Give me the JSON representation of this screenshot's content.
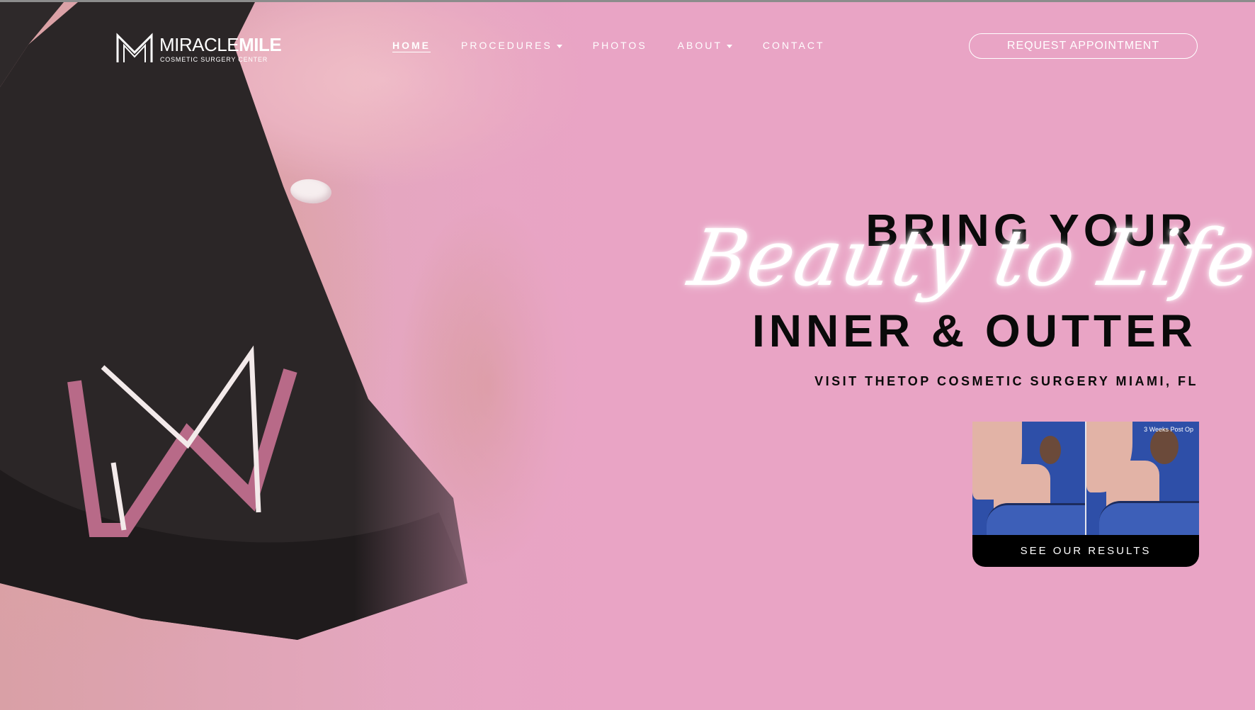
{
  "logo": {
    "word_light": "MIRACLE",
    "word_bold": "MILE",
    "tagline": "COSMETIC SURGERY CENTER"
  },
  "nav": {
    "items": [
      {
        "label": "HOME",
        "active": true,
        "dropdown": false
      },
      {
        "label": "PROCEDURES",
        "active": false,
        "dropdown": true
      },
      {
        "label": "PHOTOS",
        "active": false,
        "dropdown": false
      },
      {
        "label": "ABOUT",
        "active": false,
        "dropdown": true
      },
      {
        "label": "CONTACT",
        "active": false,
        "dropdown": false
      }
    ],
    "cta": "REQUEST APPOINTMENT"
  },
  "hero": {
    "line1": "BRING YOUR",
    "script": "Beauty to Life",
    "line3": "INNER & OUTTER",
    "subhead": "VISIT THETOP COSMETIC SURGERY MIAMI, FL"
  },
  "results": {
    "photo_label": "3 Weeks Post Op",
    "button": "SEE OUR RESULTS"
  },
  "colors": {
    "background": "#e9a4c5",
    "headline": "#0a0a0a",
    "script": "#ffffff",
    "button_bg": "#000000"
  }
}
